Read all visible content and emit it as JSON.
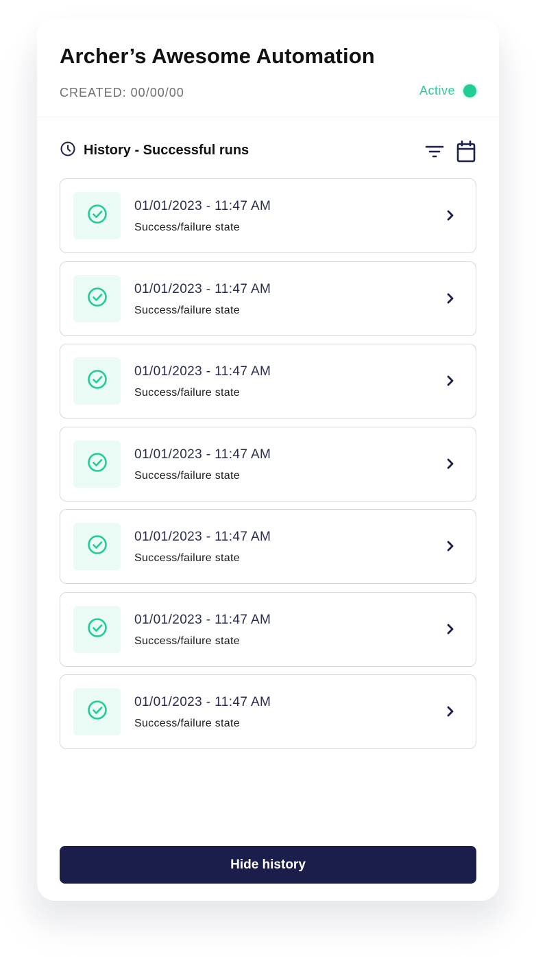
{
  "automation": {
    "title": "Archer’s Awesome Automation",
    "created_label": "CREATED: 00/00/00",
    "status_label": "Active",
    "status_color": "#22cc96"
  },
  "history": {
    "title": "History - Successful runs",
    "icons": {
      "header": "clock-icon",
      "filter": "filter-icon",
      "calendar": "calendar-icon"
    },
    "runs": [
      {
        "datetime": "01/01/2023 - 11:47 AM",
        "state": "Success/failure state",
        "icon": "check-circle-icon"
      },
      {
        "datetime": "01/01/2023 - 11:47 AM",
        "state": "Success/failure state",
        "icon": "check-circle-icon"
      },
      {
        "datetime": "01/01/2023 - 11:47 AM",
        "state": "Success/failure state",
        "icon": "check-circle-icon"
      },
      {
        "datetime": "01/01/2023 - 11:47 AM",
        "state": "Success/failure state",
        "icon": "check-circle-icon"
      },
      {
        "datetime": "01/01/2023 - 11:47 AM",
        "state": "Success/failure state",
        "icon": "check-circle-icon"
      },
      {
        "datetime": "01/01/2023 - 11:47 AM",
        "state": "Success/failure state",
        "icon": "check-circle-icon"
      },
      {
        "datetime": "01/01/2023 - 11:47 AM",
        "state": "Success/failure state",
        "icon": "check-circle-icon"
      }
    ]
  },
  "actions": {
    "hide_history_label": "Hide history"
  },
  "colors": {
    "primary": "#1b1e4b",
    "success": "#22cc96",
    "success_bg": "#eafaf4"
  }
}
